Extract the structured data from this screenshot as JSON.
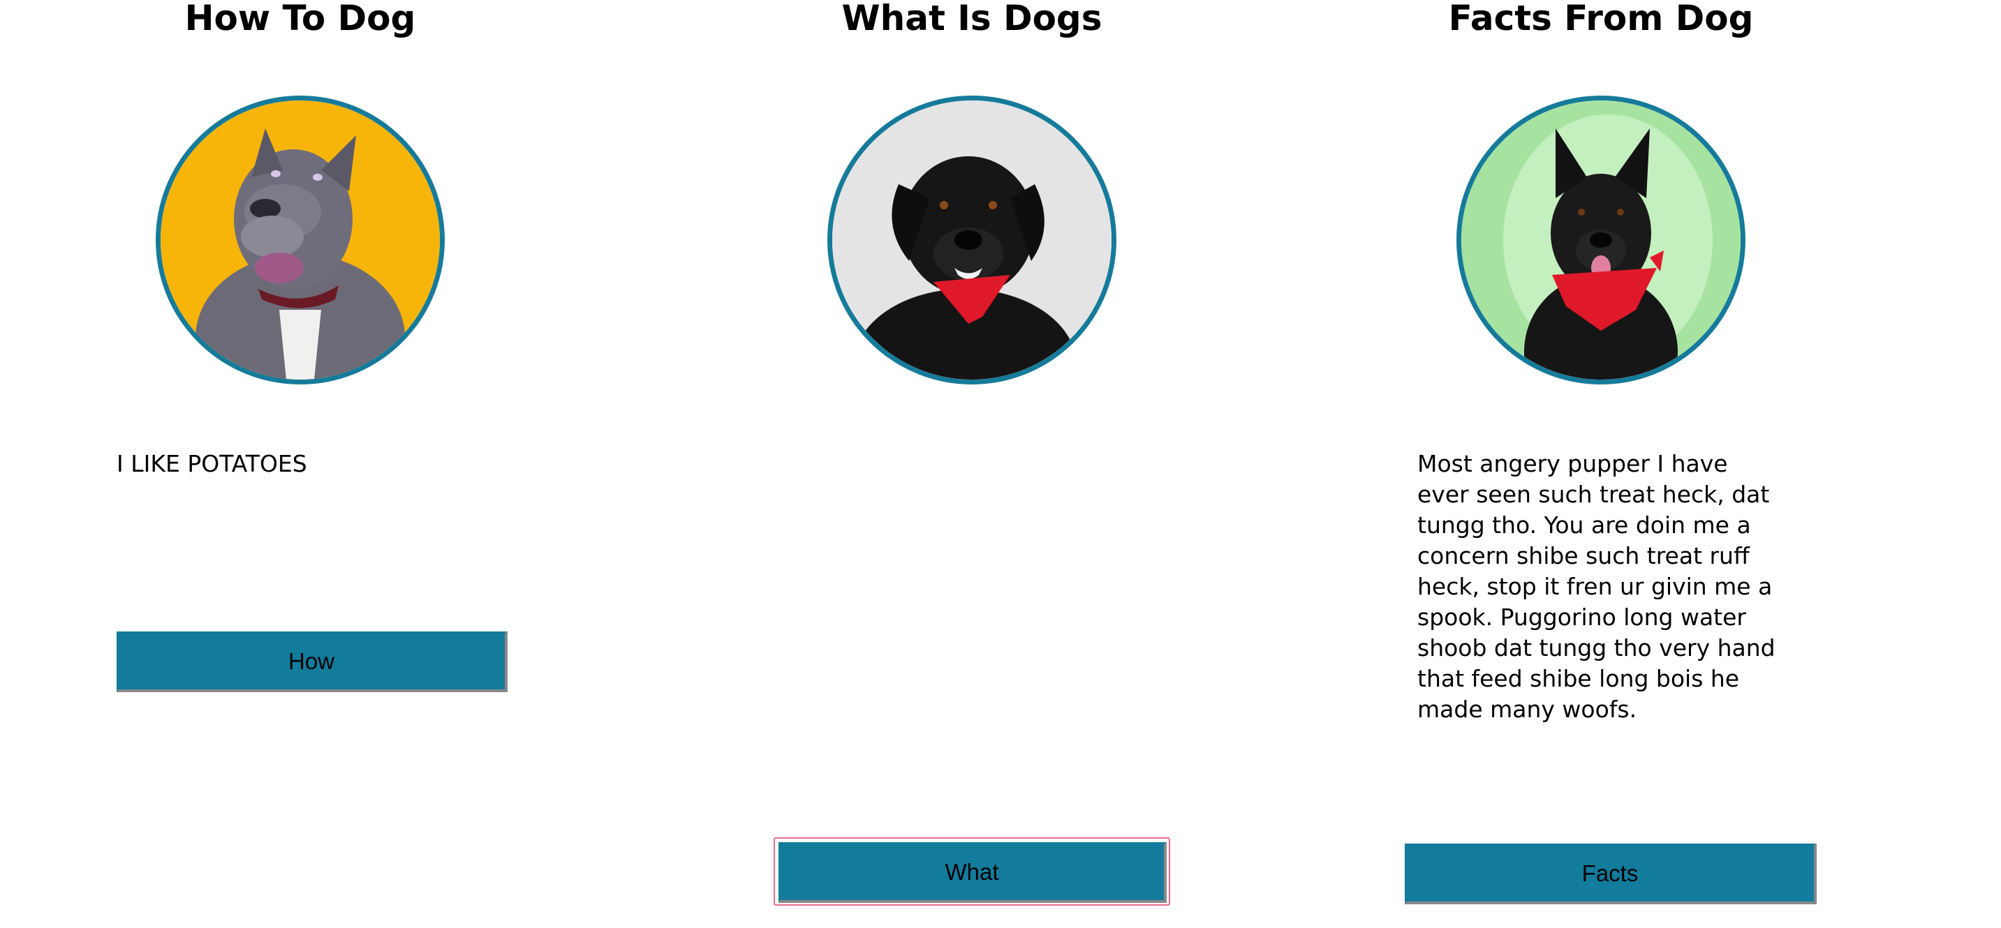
{
  "columns": [
    {
      "heading": "How To Dog",
      "description": "I LIKE POTATOES",
      "button_label": "How",
      "photo_icon": "gray-pitbull-dog-photo",
      "photo_bg": "#f7b50a"
    },
    {
      "heading": "What Is Dogs",
      "description": "",
      "button_label": "What",
      "photo_icon": "black-lab-dog-photo",
      "photo_bg": "#e4e4e4"
    },
    {
      "heading": "Facts From Dog",
      "description": "Most angery pupper I have ever seen such treat heck, dat tungg tho. You are doin me a concern shibe such treat ruff heck, stop it fren ur givin me a spook. Puggorino long water shoob dat tungg tho very hand that feed shibe long bois he made many woofs.",
      "button_label": "Facts",
      "photo_icon": "black-shepherd-dog-photo",
      "photo_bg": "#a6e3a0"
    }
  ],
  "colors": {
    "accent": "#137b9c",
    "circle_border": "#167b9a",
    "focus_ring": "#e56e8e"
  }
}
